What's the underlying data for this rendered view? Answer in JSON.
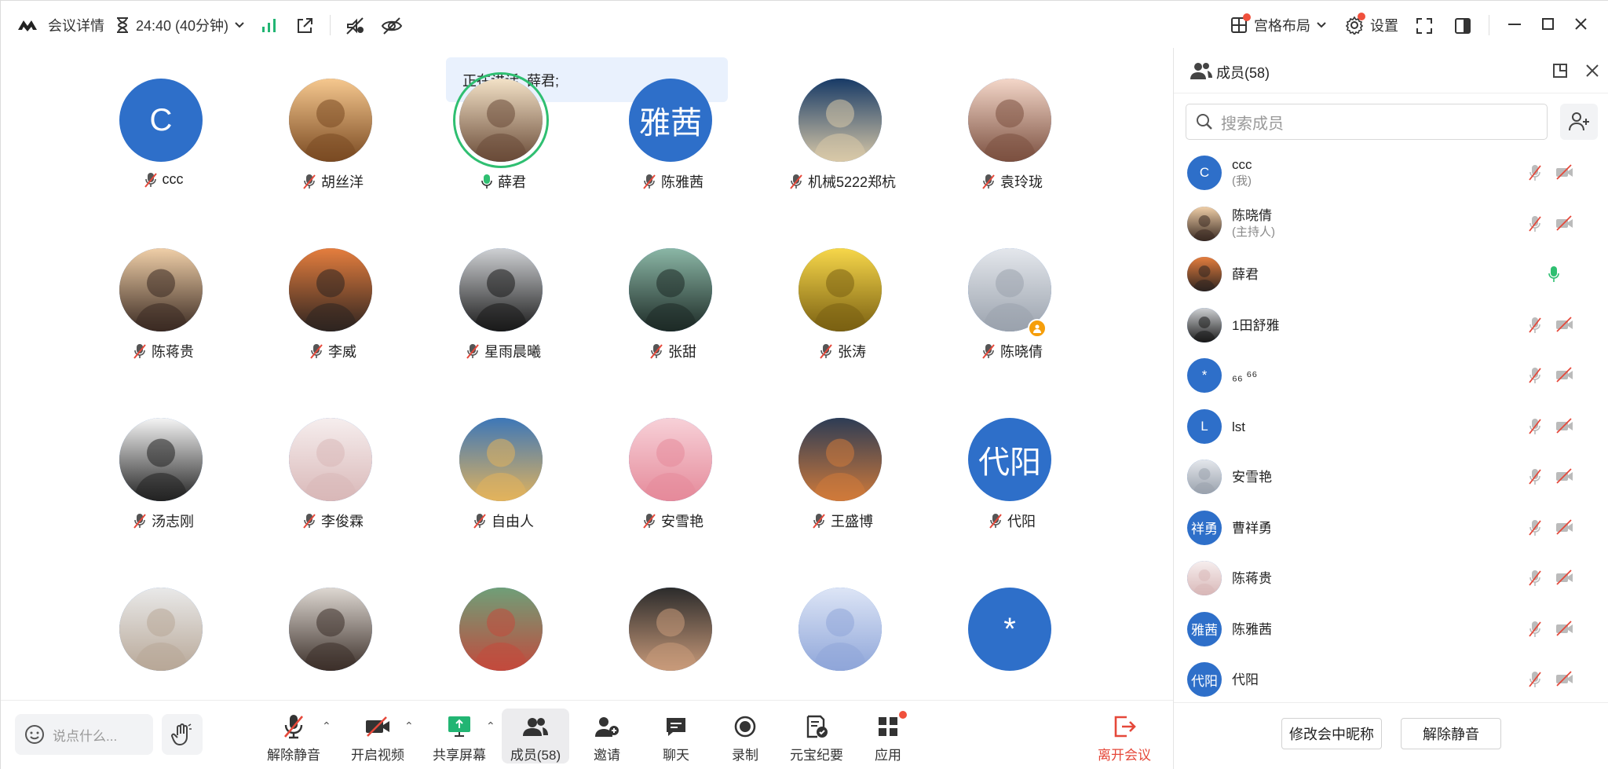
{
  "topbar": {
    "meeting_details": "会议详情",
    "timer": "24:40 (40分钟)",
    "layout_label": "宫格布局",
    "settings_label": "设置"
  },
  "speaking_banner": "正在讲话: 薛君;",
  "tiles": [
    {
      "name": "ccc",
      "initial": "C",
      "mic": "muted"
    },
    {
      "name": "胡丝洋",
      "mic": "muted"
    },
    {
      "name": "薛君",
      "mic": "on",
      "active": true
    },
    {
      "name": "陈雅茜",
      "initial": "雅茜",
      "mic": "muted"
    },
    {
      "name": "机械5222郑杭",
      "mic": "muted"
    },
    {
      "name": "袁玲珑",
      "mic": "muted"
    },
    {
      "name": "陈蒋贵",
      "mic": "muted"
    },
    {
      "name": "李威",
      "mic": "muted"
    },
    {
      "name": "星雨晨曦",
      "mic": "muted"
    },
    {
      "name": "张甜",
      "mic": "muted"
    },
    {
      "name": "张涛",
      "mic": "muted"
    },
    {
      "name": "陈晓倩",
      "mic": "muted",
      "host": true
    },
    {
      "name": "汤志刚",
      "mic": "muted"
    },
    {
      "name": "李俊霖",
      "mic": "muted"
    },
    {
      "name": "自由人",
      "mic": "muted"
    },
    {
      "name": "安雪艳",
      "mic": "muted"
    },
    {
      "name": "王盛博",
      "mic": "muted"
    },
    {
      "name": "代阳",
      "initial": "代阳",
      "mic": "muted"
    },
    {
      "name": "",
      "mic": "none"
    },
    {
      "name": "",
      "mic": "none"
    },
    {
      "name": "",
      "mic": "none"
    },
    {
      "name": "",
      "mic": "none"
    },
    {
      "name": "",
      "mic": "none"
    },
    {
      "name": "",
      "initial": "*",
      "mic": "none"
    }
  ],
  "toolbar": {
    "chat_placeholder": "说点什么...",
    "unmute": "解除静音",
    "start_video": "开启视频",
    "share_screen": "共享屏幕",
    "members": "成员(58)",
    "invite": "邀请",
    "chat": "聊天",
    "record": "录制",
    "ai_minutes": "元宝纪要",
    "apps": "应用",
    "leave": "离开会议"
  },
  "panel": {
    "title": "成员(58)",
    "search_placeholder": "搜索成员",
    "members": [
      {
        "name": "ccc",
        "role": "(我)",
        "initial": "C",
        "mic": "muted"
      },
      {
        "name": "陈晓倩",
        "role": "(主持人)",
        "mic": "muted"
      },
      {
        "name": "薛君",
        "mic": "on"
      },
      {
        "name": "1田舒雅",
        "mic": "muted"
      },
      {
        "name": "₆₆ ⁶⁶",
        "initial": "*",
        "mic": "muted"
      },
      {
        "name": "lst",
        "initial": "L",
        "mic": "muted"
      },
      {
        "name": "安雪艳",
        "mic": "muted"
      },
      {
        "name": "曹祥勇",
        "initial": "祥勇",
        "mic": "muted"
      },
      {
        "name": "陈蒋贵",
        "mic": "muted"
      },
      {
        "name": "陈雅茜",
        "initial": "雅茜",
        "mic": "muted"
      },
      {
        "name": "代阳",
        "initial": "代阳",
        "mic": "muted"
      }
    ],
    "rename_button": "修改会中昵称",
    "unmute_button": "解除静音"
  },
  "colors": {
    "accent": "#2e6fc9",
    "active": "#2fbf71",
    "leave": "#e5483a",
    "banner": "#e9f1fd"
  }
}
